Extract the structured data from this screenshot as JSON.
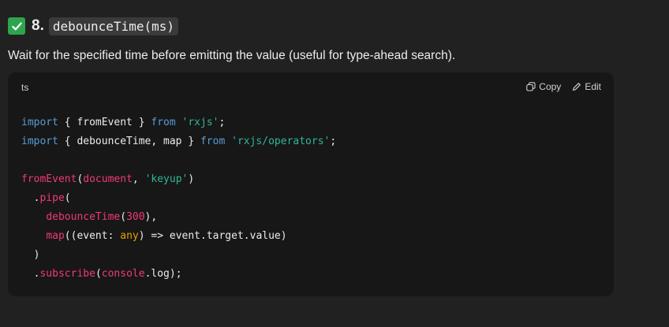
{
  "heading": {
    "number": "8.",
    "code": "debounceTime(ms)"
  },
  "description": "Wait for the specified time before emitting the value (useful for type-ahead search).",
  "code_block": {
    "language": "ts",
    "copy_label": "Copy",
    "edit_label": "Edit",
    "lines": [
      [
        {
          "t": "import",
          "c": "kw"
        },
        {
          "t": " { fromEvent } ",
          "c": "pl"
        },
        {
          "t": "from",
          "c": "kw"
        },
        {
          "t": " ",
          "c": "pl"
        },
        {
          "t": "'rxjs'",
          "c": "str"
        },
        {
          "t": ";",
          "c": "pl"
        }
      ],
      [
        {
          "t": "import",
          "c": "kw"
        },
        {
          "t": " { debounceTime, map } ",
          "c": "pl"
        },
        {
          "t": "from",
          "c": "kw"
        },
        {
          "t": " ",
          "c": "pl"
        },
        {
          "t": "'rxjs/operators'",
          "c": "str"
        },
        {
          "t": ";",
          "c": "pl"
        }
      ],
      [],
      [
        {
          "t": "fromEvent",
          "c": "fn"
        },
        {
          "t": "(",
          "c": "pl"
        },
        {
          "t": "document",
          "c": "fn"
        },
        {
          "t": ", ",
          "c": "pl"
        },
        {
          "t": "'keyup'",
          "c": "str"
        },
        {
          "t": ")",
          "c": "pl"
        }
      ],
      [
        {
          "t": "  .",
          "c": "pl"
        },
        {
          "t": "pipe",
          "c": "fn"
        },
        {
          "t": "(",
          "c": "pl"
        }
      ],
      [
        {
          "t": "    ",
          "c": "pl"
        },
        {
          "t": "debounceTime",
          "c": "fn"
        },
        {
          "t": "(",
          "c": "pl"
        },
        {
          "t": "300",
          "c": "num"
        },
        {
          "t": "),",
          "c": "pl"
        }
      ],
      [
        {
          "t": "    ",
          "c": "pl"
        },
        {
          "t": "map",
          "c": "fn"
        },
        {
          "t": "((event: ",
          "c": "pl"
        },
        {
          "t": "any",
          "c": "type"
        },
        {
          "t": ") => event.target.value)",
          "c": "pl"
        }
      ],
      [
        {
          "t": "  )",
          "c": "pl"
        }
      ],
      [
        {
          "t": "  .",
          "c": "pl"
        },
        {
          "t": "subscribe",
          "c": "fn"
        },
        {
          "t": "(",
          "c": "pl"
        },
        {
          "t": "console",
          "c": "fn"
        },
        {
          "t": ".log);",
          "c": "pl"
        }
      ]
    ]
  },
  "colors": {
    "background": "#212121",
    "code_background": "#171717",
    "keyword": "#569cd6",
    "string": "#2fb795",
    "function": "#f0397a",
    "type": "#e7a000",
    "check": "#2ea44f"
  },
  "icons": {
    "heading": "check-mark-icon",
    "copy": "copy-icon",
    "edit": "edit-pencil-icon"
  }
}
